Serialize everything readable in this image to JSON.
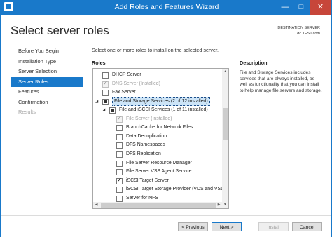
{
  "window": {
    "title": "Add Roles and Features Wizard"
  },
  "header": {
    "page_title": "Select server roles",
    "destination_label": "DESTINATION SERVER",
    "destination_server": "dc.TEST.com"
  },
  "nav": {
    "items": [
      {
        "label": "Before You Begin",
        "state": "normal"
      },
      {
        "label": "Installation Type",
        "state": "normal"
      },
      {
        "label": "Server Selection",
        "state": "normal"
      },
      {
        "label": "Server Roles",
        "state": "active"
      },
      {
        "label": "Features",
        "state": "normal"
      },
      {
        "label": "Confirmation",
        "state": "normal"
      },
      {
        "label": "Results",
        "state": "disabled"
      }
    ]
  },
  "main": {
    "instruction": "Select one or more roles to install on the selected server.",
    "roles_label": "Roles",
    "description_label": "Description",
    "description_text": "File and Storage Services includes services that are always installed, as well as functionality that you can install to help manage file servers and storage."
  },
  "roles": [
    {
      "label": "DHCP Server",
      "check": "unchecked",
      "level": 0,
      "expander": "",
      "enabled": true
    },
    {
      "label": "DNS Server (Installed)",
      "check": "checked",
      "level": 0,
      "expander": "",
      "enabled": false
    },
    {
      "label": "Fax Server",
      "check": "unchecked",
      "level": 0,
      "expander": "",
      "enabled": true
    },
    {
      "label": "File and Storage Services (2 of 12 installed)",
      "check": "indeterminate",
      "level": 0,
      "expander": "expanded",
      "enabled": true,
      "selected": true
    },
    {
      "label": "File and iSCSI Services (1 of 11 installed)",
      "check": "indeterminate",
      "level": 1,
      "expander": "expanded",
      "enabled": true
    },
    {
      "label": "File Server (Installed)",
      "check": "checked",
      "level": 2,
      "expander": "",
      "enabled": false
    },
    {
      "label": "BranchCache for Network Files",
      "check": "unchecked",
      "level": 2,
      "expander": "",
      "enabled": true
    },
    {
      "label": "Data Deduplication",
      "check": "unchecked",
      "level": 2,
      "expander": "",
      "enabled": true
    },
    {
      "label": "DFS Namespaces",
      "check": "unchecked",
      "level": 2,
      "expander": "",
      "enabled": true
    },
    {
      "label": "DFS Replication",
      "check": "unchecked",
      "level": 2,
      "expander": "",
      "enabled": true
    },
    {
      "label": "File Server Resource Manager",
      "check": "unchecked",
      "level": 2,
      "expander": "",
      "enabled": true
    },
    {
      "label": "File Server VSS Agent Service",
      "check": "unchecked",
      "level": 2,
      "expander": "",
      "enabled": true
    },
    {
      "label": "iSCSI Target Server",
      "check": "checked",
      "level": 2,
      "expander": "",
      "enabled": true
    },
    {
      "label": "iSCSI Target Storage Provider (VDS and VSS",
      "check": "unchecked",
      "level": 2,
      "expander": "",
      "enabled": true
    },
    {
      "label": "Server for NFS",
      "check": "unchecked",
      "level": 2,
      "expander": "",
      "enabled": true
    }
  ],
  "footer": {
    "previous_label": "< Previous",
    "next_label": "Next >",
    "install_label": "Install",
    "cancel_label": "Cancel"
  },
  "colors": {
    "accent": "#1979ca",
    "close": "#c7463a"
  }
}
